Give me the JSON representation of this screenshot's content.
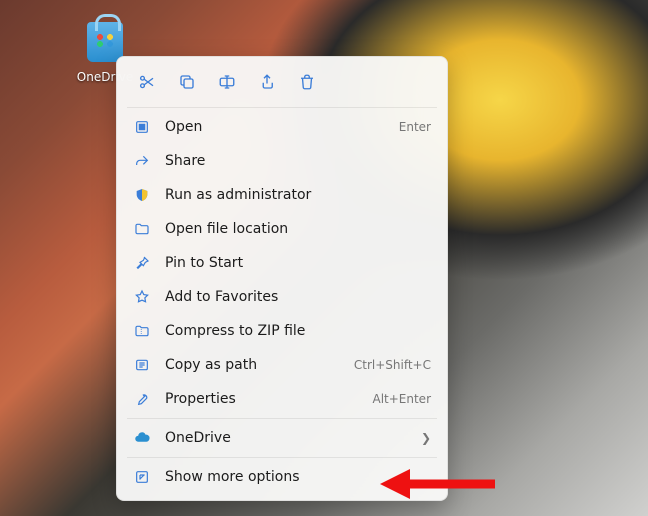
{
  "desktop": {
    "icon_label": "OneDrive"
  },
  "toolbar": {
    "cut": "Cut",
    "copy": "Copy",
    "rename": "Rename",
    "share": "Share",
    "delete": "Delete"
  },
  "menu": {
    "open": {
      "label": "Open",
      "shortcut": "Enter"
    },
    "share": {
      "label": "Share"
    },
    "run_admin": {
      "label": "Run as administrator"
    },
    "open_location": {
      "label": "Open file location"
    },
    "pin_start": {
      "label": "Pin to Start"
    },
    "add_fav": {
      "label": "Add to Favorites"
    },
    "compress": {
      "label": "Compress to ZIP file"
    },
    "copy_path": {
      "label": "Copy as path",
      "shortcut": "Ctrl+Shift+C"
    },
    "properties": {
      "label": "Properties",
      "shortcut": "Alt+Enter"
    },
    "onedrive": {
      "label": "OneDrive"
    },
    "more": {
      "label": "Show more options"
    }
  },
  "colors": {
    "accent": "#3b7dd8",
    "text": "#1b1b1b",
    "muted": "#767676"
  }
}
